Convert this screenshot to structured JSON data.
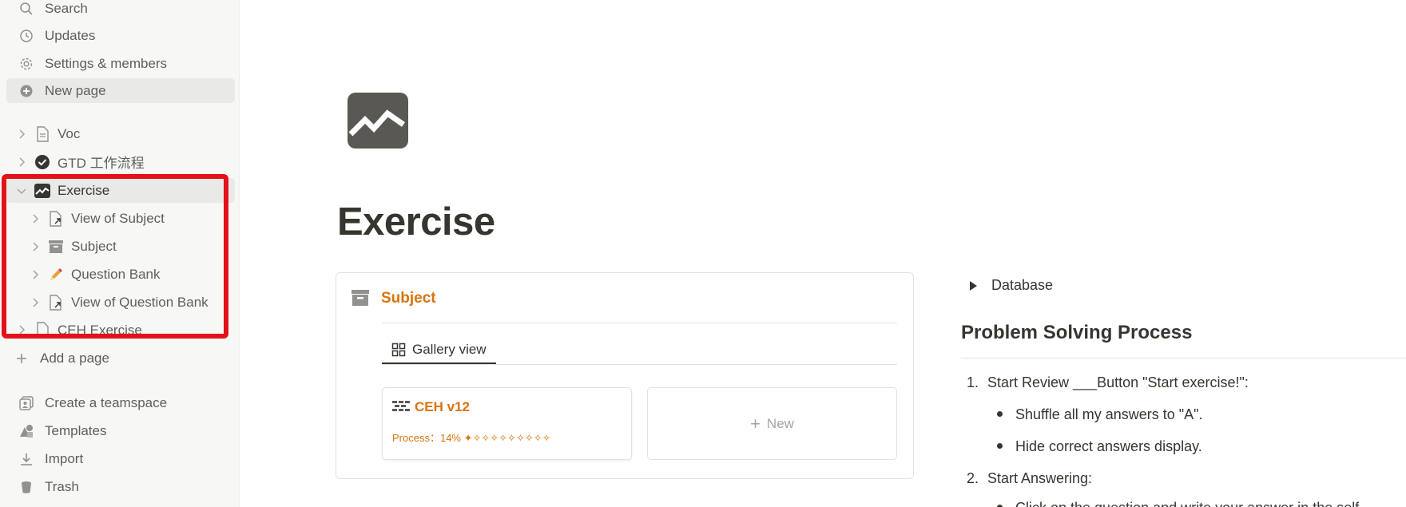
{
  "sidebar": {
    "top_items": [
      {
        "label": "Search",
        "icon": "search-icon"
      },
      {
        "label": "Updates",
        "icon": "clock-icon"
      },
      {
        "label": "Settings & members",
        "icon": "gear-icon"
      },
      {
        "label": "New page",
        "icon": "plus-circle-icon"
      }
    ],
    "pages": [
      {
        "label": "Voc",
        "icon": "page-icon"
      },
      {
        "label": "GTD 工作流程",
        "icon": "check-circle-icon"
      },
      {
        "label": "Exercise",
        "icon": "chart-icon"
      },
      {
        "label": "View of Subject",
        "icon": "linked-page-icon"
      },
      {
        "label": "Subject",
        "icon": "archive-icon"
      },
      {
        "label": "Question Bank",
        "icon": "pencil-icon"
      },
      {
        "label": "View of Question Bank",
        "icon": "linked-page-icon"
      },
      {
        "label": "CEH Exercise",
        "icon": "page-icon"
      }
    ],
    "add_page": "Add a page",
    "bottom_items": [
      {
        "label": "Create a teamspace",
        "icon": "teamspace-icon"
      },
      {
        "label": "Templates",
        "icon": "templates-icon"
      },
      {
        "label": "Import",
        "icon": "download-icon"
      },
      {
        "label": "Trash",
        "icon": "trash-icon"
      }
    ]
  },
  "page": {
    "title": "Exercise",
    "icon": "chart-icon"
  },
  "database": {
    "title": "Subject",
    "view_tab": "Gallery view",
    "cards": [
      {
        "title": "CEH v12",
        "property": "Process：14% ✦✧✧✧✧✧✧✧✧✧"
      }
    ],
    "new_label": "New"
  },
  "content": {
    "toggle": "Database",
    "heading": "Problem Solving Process",
    "steps": [
      {
        "num": "1.",
        "text": "Start Review ___Button \"Start exercise!\":"
      },
      {
        "num": "2.",
        "text": "Start Answering:"
      }
    ],
    "bullets": [
      "Shuffle all my answers to \"A\".",
      "Hide correct answers display."
    ],
    "cut_line": "Click on the question and write your answer in the self"
  },
  "colors": {
    "accent_orange": "#d9730d",
    "highlight_red": "#e3121a",
    "sidebar_bg": "#f7f7f5"
  }
}
